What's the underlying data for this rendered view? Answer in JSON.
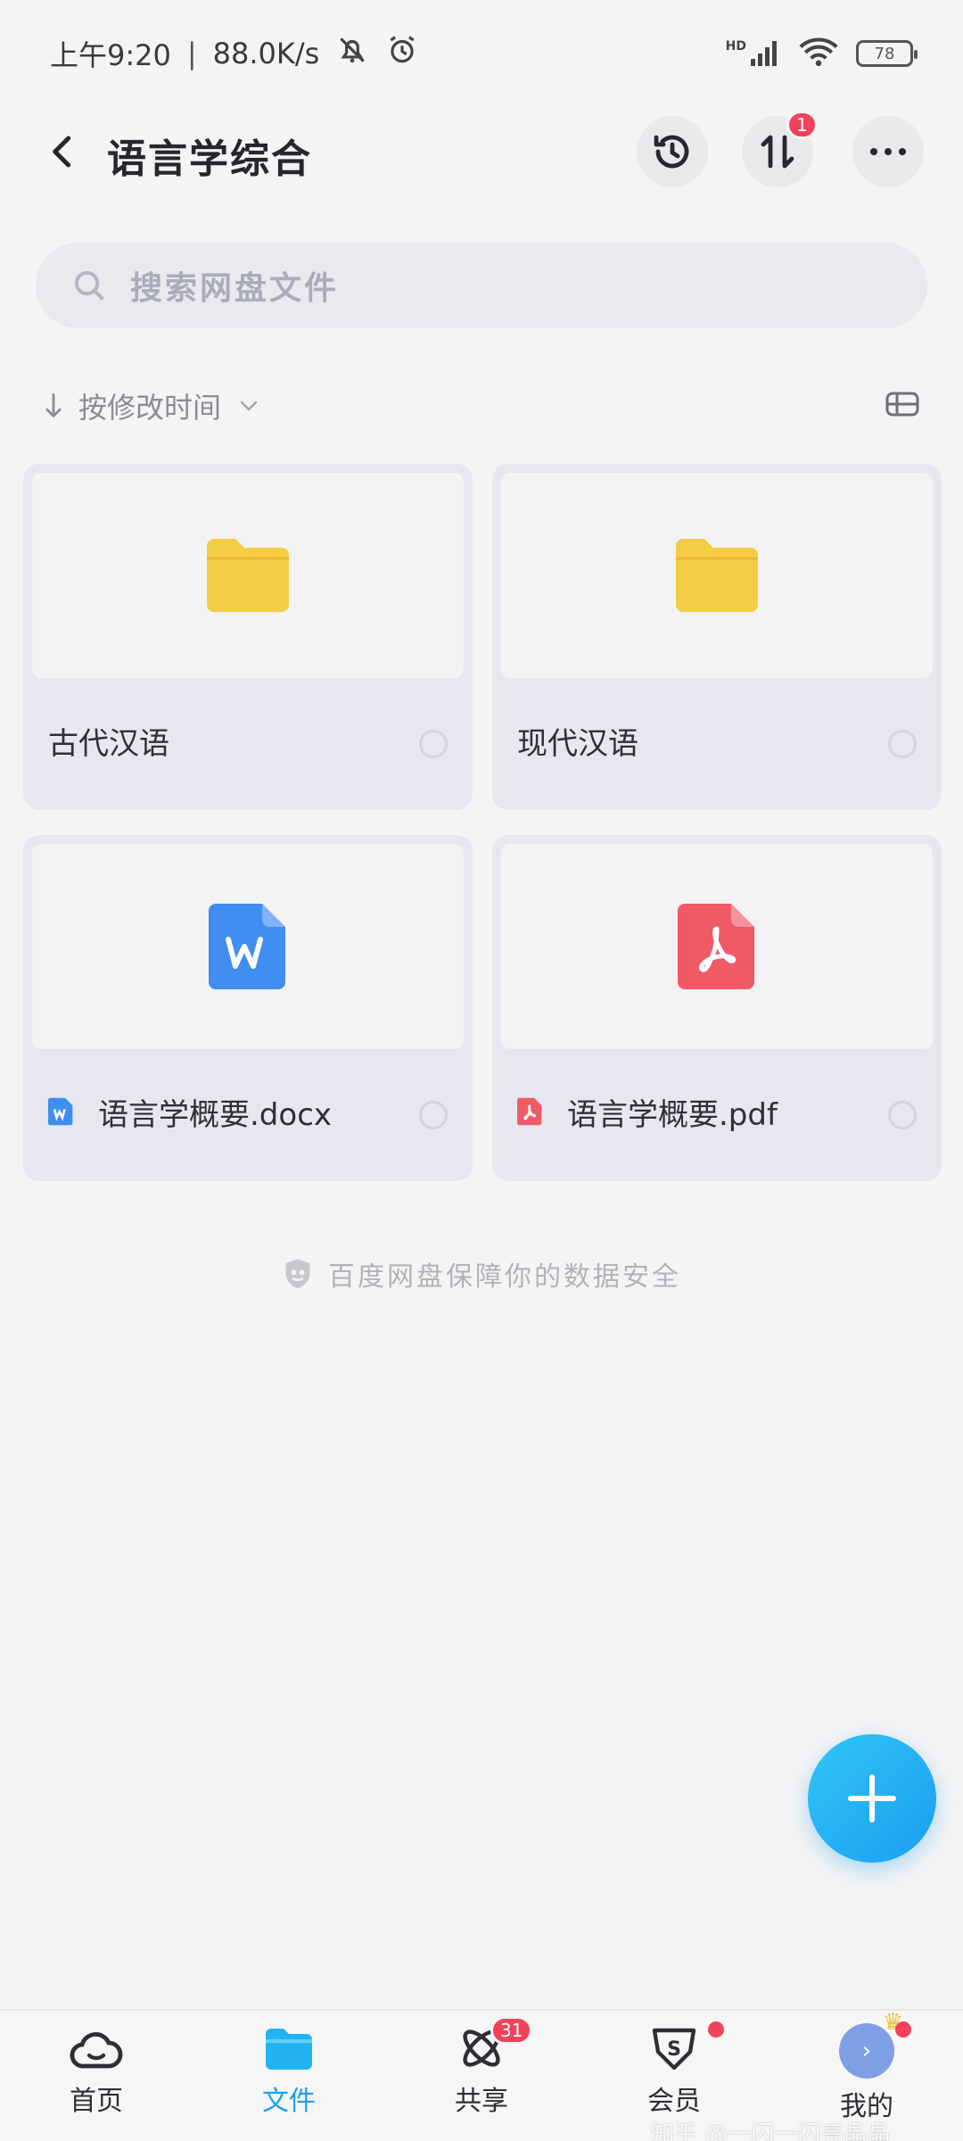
{
  "status_bar": {
    "time": "上午9:20",
    "speed": "88.0K/s",
    "network": "HD",
    "battery": "78"
  },
  "header": {
    "title": "语言学综合",
    "transfer_badge": "1"
  },
  "search": {
    "placeholder": "搜索网盘文件"
  },
  "sort": {
    "label": "按修改时间"
  },
  "files": [
    {
      "name": "古代汉语",
      "type": "folder"
    },
    {
      "name": "现代汉语",
      "type": "folder"
    },
    {
      "name": "语言学概要.docx",
      "type": "word"
    },
    {
      "name": "语言学概要.pdf",
      "type": "pdf"
    }
  ],
  "safety_text": "百度网盘保障你的数据安全",
  "bottom_nav": [
    {
      "label": "首页",
      "icon": "cloud-icon",
      "active": false
    },
    {
      "label": "文件",
      "icon": "folder-icon",
      "active": true
    },
    {
      "label": "共享",
      "icon": "share-atom-icon",
      "active": false,
      "badge": "31"
    },
    {
      "label": "会员",
      "icon": "vip-s-icon",
      "active": false
    },
    {
      "label": "我的",
      "icon": "avatar-icon",
      "active": false
    }
  ],
  "watermark": "知乎 @一闪一闪亮晶晶",
  "colors": {
    "accent": "#1c9ff1",
    "badge": "#f2425a",
    "folder": "#f5cd45",
    "word": "#3f8ef0",
    "pdf": "#ef5a66"
  }
}
